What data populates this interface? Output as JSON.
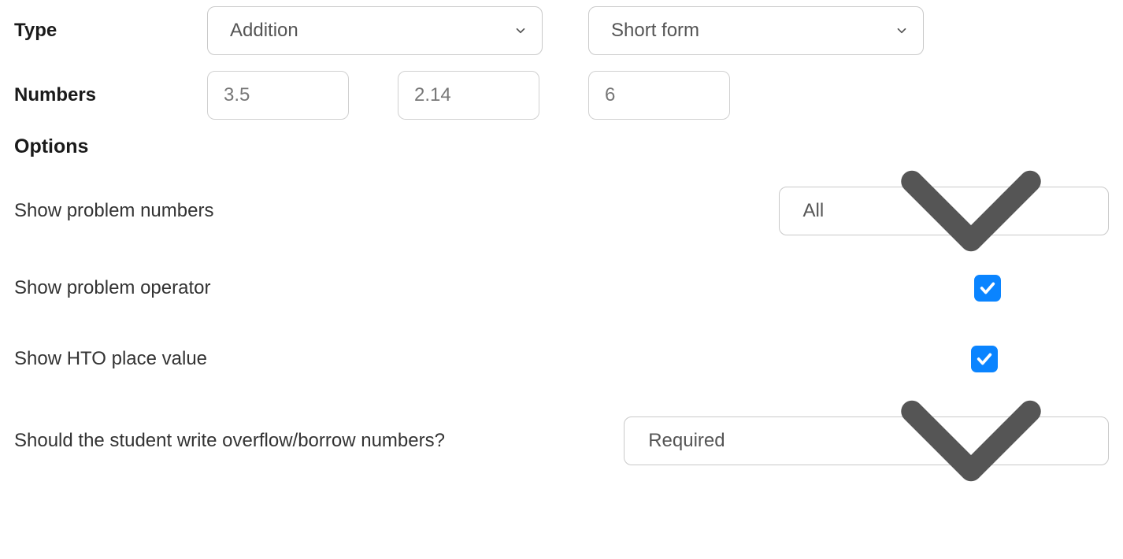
{
  "labels": {
    "type": "Type",
    "numbers": "Numbers",
    "options": "Options"
  },
  "type_select": {
    "value": "Addition"
  },
  "form_select": {
    "value": "Short form"
  },
  "numbers_inputs": {
    "n1": "3.5",
    "n2": "2.14",
    "n3": "6"
  },
  "options": {
    "show_problem_numbers": {
      "label": "Show problem numbers",
      "value": "All"
    },
    "show_problem_operator": {
      "label": "Show problem operator",
      "checked": true
    },
    "show_hto": {
      "label": "Show HTO place value",
      "checked": true
    },
    "overflow_borrow": {
      "label": "Should the student write overflow/borrow numbers?",
      "value": "Required"
    }
  }
}
